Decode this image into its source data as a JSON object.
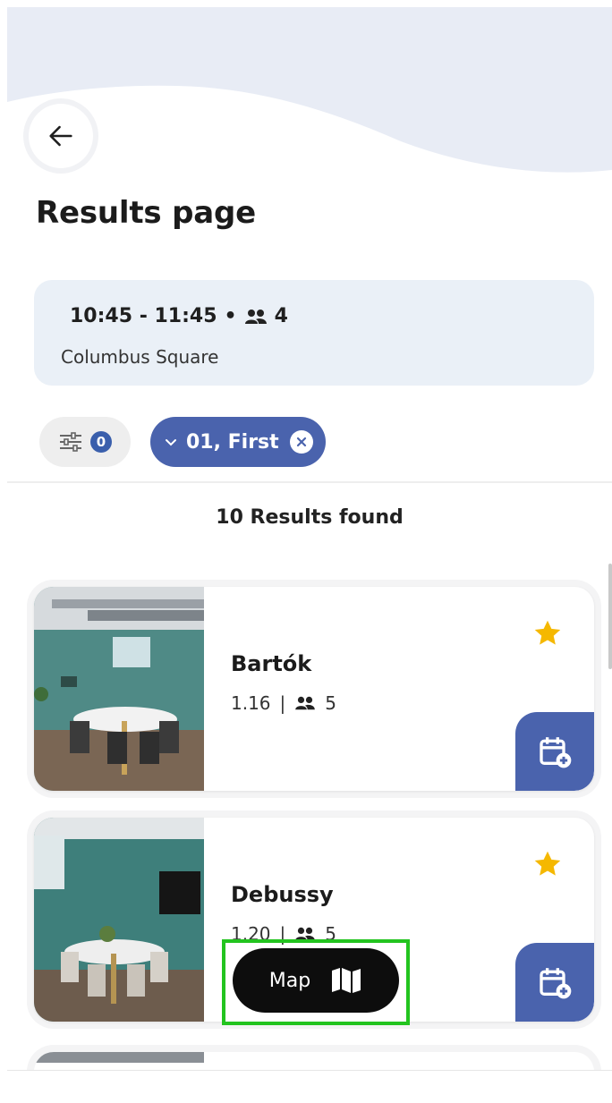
{
  "header": {
    "back_icon": "arrow-left-icon",
    "title": "Results page"
  },
  "booking": {
    "time_range": "10:45 - 11:45",
    "separator": "•",
    "people_icon": "people-icon",
    "attendees": "4",
    "location": "Columbus Square"
  },
  "filters": {
    "filter_icon": "sliders-icon",
    "filter_count": "0",
    "floor_chip": {
      "chevron_icon": "chevron-down-icon",
      "label": "01, First",
      "clear_icon": "close-icon"
    }
  },
  "results": {
    "count_label": "10 Results found",
    "rooms": [
      {
        "name": "Bartók",
        "number": "1.16",
        "separator": "|",
        "capacity": "5",
        "favorite": true
      },
      {
        "name": "Debussy",
        "number": "1.20",
        "separator": "|",
        "capacity": "5",
        "favorite": true
      }
    ]
  },
  "map_button": {
    "label": "Map",
    "icon": "map-icon"
  },
  "colors": {
    "accent": "#4a63ad",
    "star": "#f5b800",
    "summary_bg": "#eaf0f7",
    "wave": "#e8ecf5",
    "highlight": "#23c41f"
  }
}
